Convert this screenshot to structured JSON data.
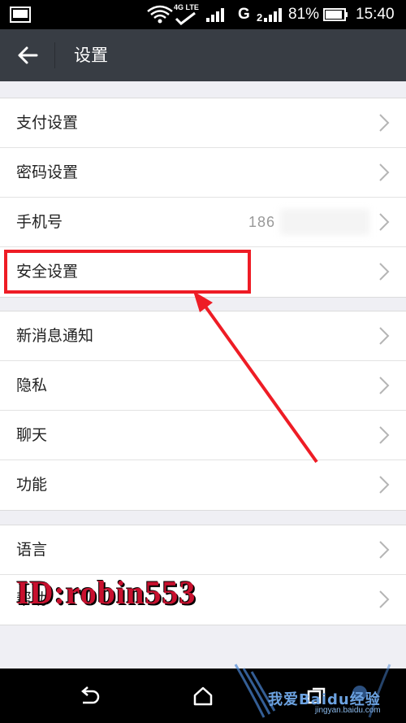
{
  "status_bar": {
    "network_type": "4G LTE",
    "carrier_g": "G",
    "battery": "81%",
    "time": "15:40"
  },
  "app_bar": {
    "title": "设置",
    "back_icon": "arrow-left-icon"
  },
  "groups": [
    {
      "items": [
        {
          "label": "支付设置"
        },
        {
          "label": "密码设置"
        },
        {
          "label": "手机号",
          "value": "186"
        },
        {
          "label": "安全设置"
        }
      ]
    },
    {
      "items": [
        {
          "label": "新消息通知"
        },
        {
          "label": "隐私"
        },
        {
          "label": "聊天"
        },
        {
          "label": "功能"
        }
      ]
    },
    {
      "items": [
        {
          "label": "语言"
        },
        {
          "label": "帮助"
        }
      ]
    }
  ],
  "annotation": {
    "color": "#ee1c25"
  },
  "watermark": {
    "text": "ID:robin553"
  },
  "nav_bar": {
    "icons": [
      "back-icon",
      "home-icon",
      "recent-apps-icon"
    ]
  },
  "brand": {
    "text": "我爱Baidu经验",
    "url": "jingyan.baidu.com"
  }
}
